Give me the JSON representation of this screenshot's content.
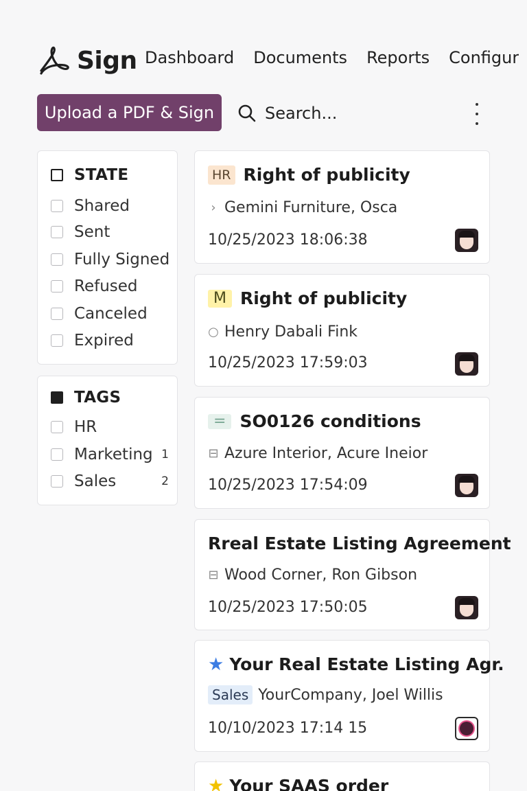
{
  "app": {
    "name": "Sign"
  },
  "nav": [
    "Dashboard",
    "Documents",
    "Reports",
    "Configura"
  ],
  "toolbar": {
    "upload_label": "Upload a PDF & Sign",
    "search_placeholder": "Search..."
  },
  "filters": {
    "state": {
      "title": "STATE",
      "options": [
        "Shared",
        "Sent",
        "Fully Signed",
        "Refused",
        "Canceled",
        "Expired"
      ]
    },
    "tags": {
      "title": "TAGS",
      "options": [
        {
          "label": "HR",
          "count": ""
        },
        {
          "label": "Marketing",
          "count": "1"
        },
        {
          "label": "Sales",
          "count": "2"
        }
      ]
    }
  },
  "documents": [
    {
      "badge": "HR",
      "title": "Right of publicity",
      "subtitle": "Gemini Furniture, Osca",
      "date": "10/25/2023 18:06:38",
      "sub_icon": "chevron-right-icon"
    },
    {
      "badge": "M",
      "title": "Right of publicity",
      "subtitle": "Henry Dabali Fink",
      "date": "10/25/2023 17:59:03",
      "sub_icon": "circle-icon"
    },
    {
      "badge": "=",
      "title": "SO0126 conditions",
      "subtitle": "Azure Interior, Acure Ineior",
      "date": "10/25/2023 17:54:09",
      "sub_icon": "doc-icon"
    },
    {
      "badge": "",
      "title": "Rreal Estate Listing Agreement",
      "subtitle": "Wood Corner, Ron Gibson",
      "date": "10/25/2023 17:50:05",
      "sub_icon": "doc-icon"
    },
    {
      "badge": "",
      "title": "Your Real Estate Listing Agr.",
      "tag": "Sales",
      "subtitle": "YourCompany, Joel Willis",
      "date": "10/10/2023 17:14 15",
      "sub_icon": ""
    },
    {
      "badge": "",
      "title": "Your SAAS order",
      "subtitle": "",
      "date": "",
      "sub_icon": ""
    }
  ],
  "colors": {
    "primary": "#71406a",
    "star_blue": "#3d7de3",
    "star_gold": "#f2c200"
  }
}
